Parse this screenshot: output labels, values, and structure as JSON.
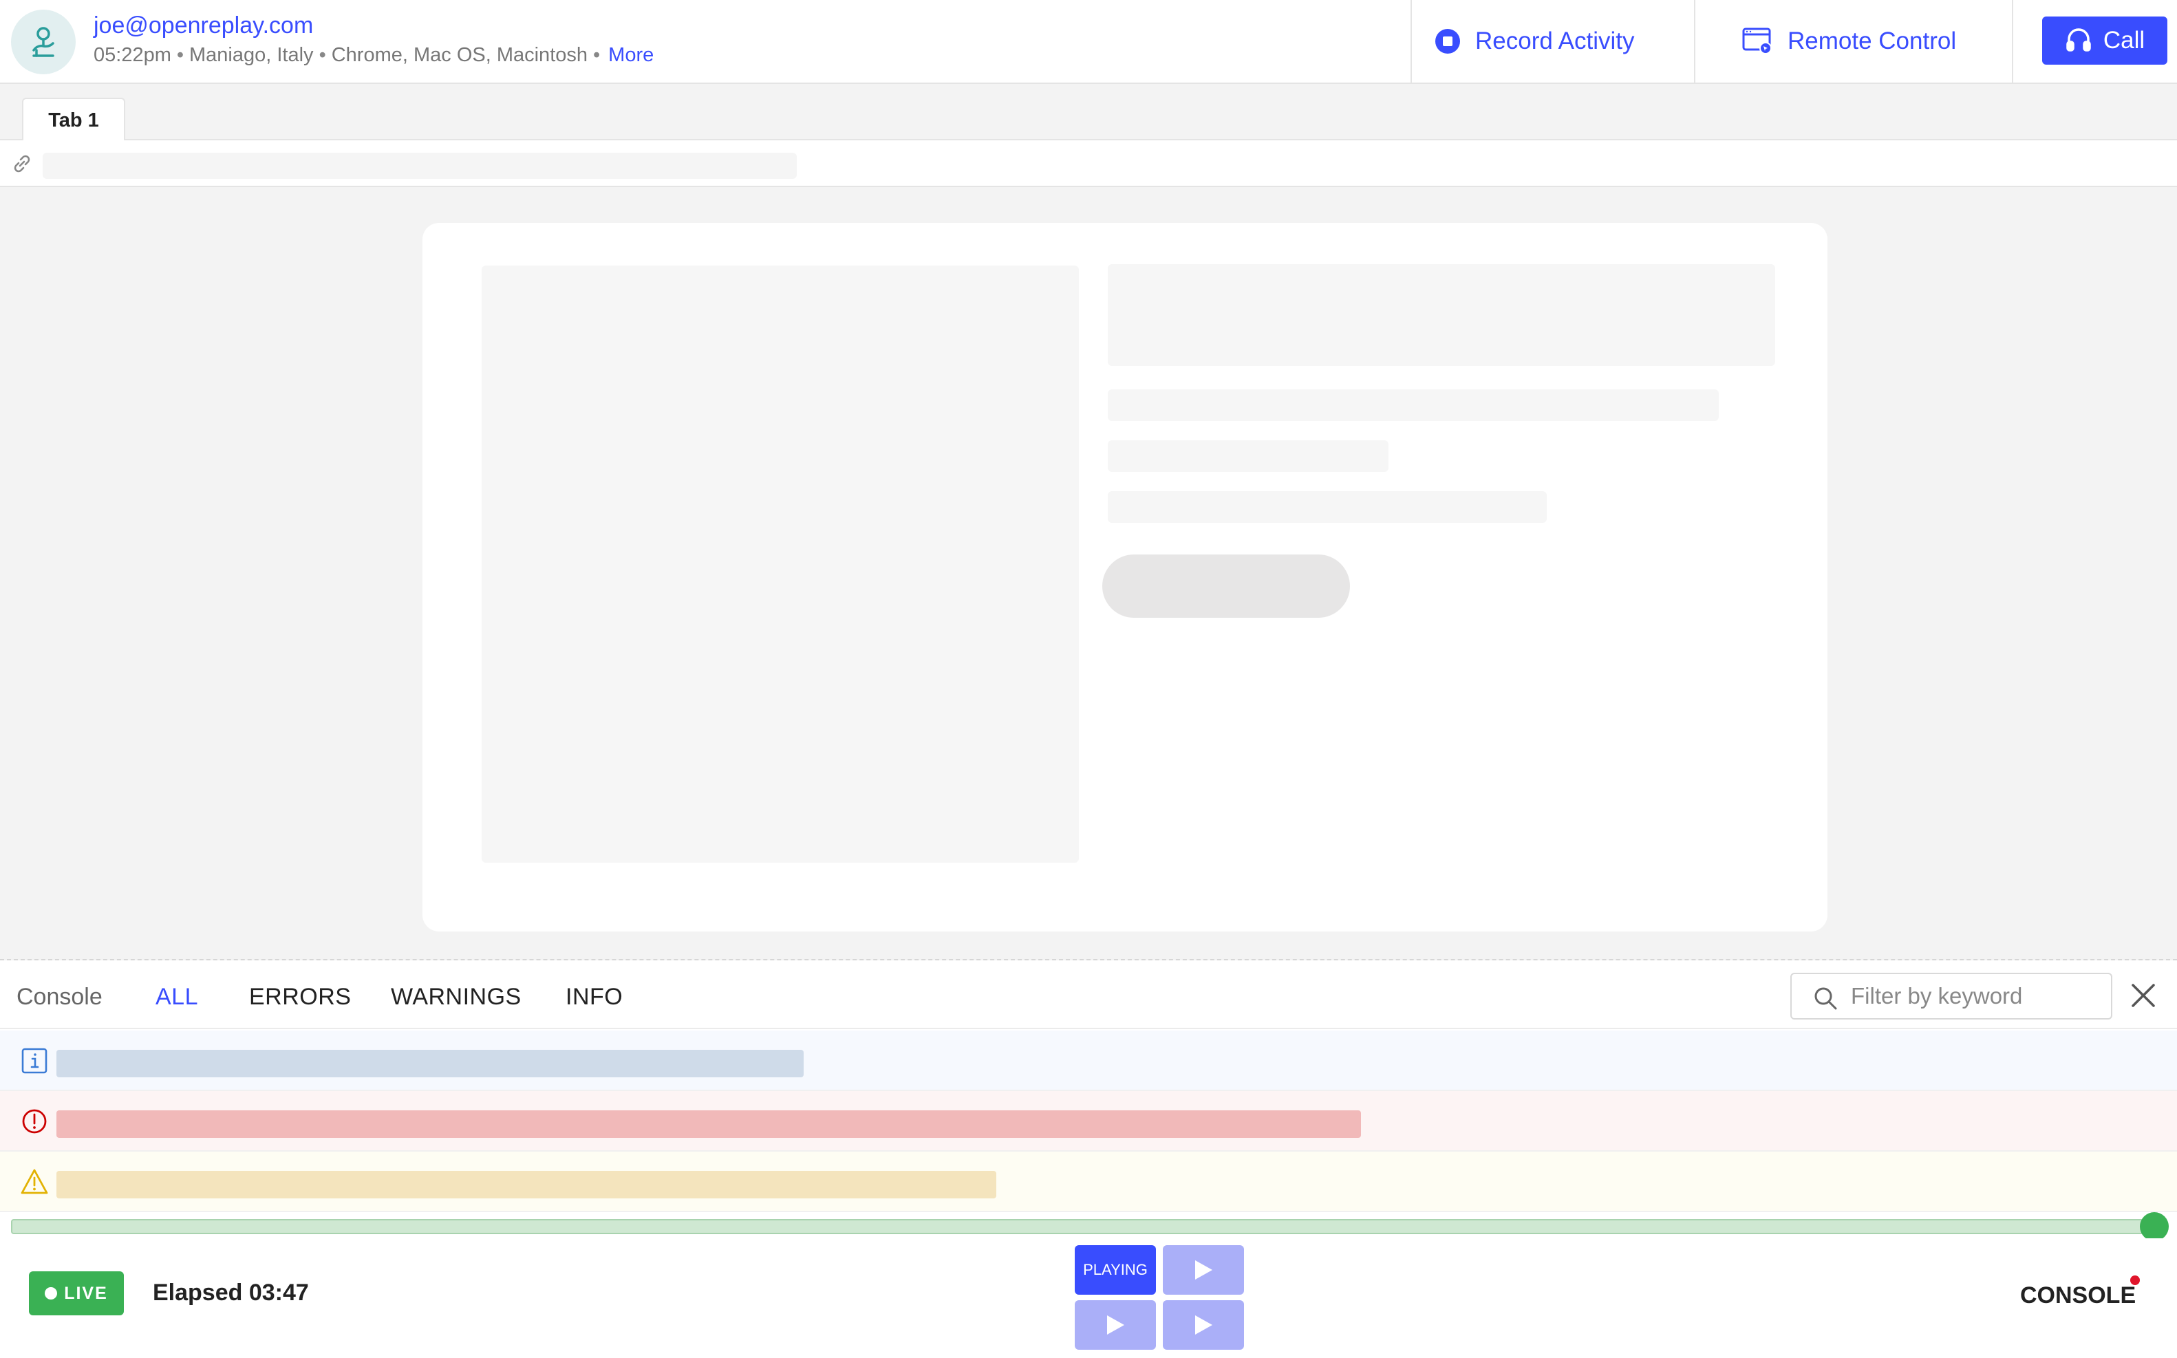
{
  "session": {
    "user_email": "joe@openreplay.com",
    "time": "05:22pm",
    "location": "Maniago, Italy",
    "environment": "Chrome, Mac OS, Macintosh",
    "more_label": "More",
    "separator": "•"
  },
  "header_actions": {
    "record_label": "Record Activity",
    "remote_label": "Remote Control",
    "call_label": "Call"
  },
  "tabs": [
    {
      "label": "Tab 1",
      "active": true
    }
  ],
  "console": {
    "title": "Console",
    "filters": [
      {
        "label": "ALL",
        "active": true
      },
      {
        "label": "ERRORS",
        "active": false
      },
      {
        "label": "WARNINGS",
        "active": false
      },
      {
        "label": "INFO",
        "active": false
      }
    ],
    "search_placeholder": "Filter by keyword",
    "rows": [
      {
        "level": "info",
        "icon": "info-icon"
      },
      {
        "level": "error",
        "icon": "error-icon"
      },
      {
        "level": "warning",
        "icon": "warning-icon"
      }
    ]
  },
  "timeline": {
    "progress": 1.0
  },
  "player": {
    "live_label": "LIVE",
    "elapsed_label": "Elapsed 03:47",
    "playing_label": "PLAYING",
    "console_toggle_label": "CONSOLE"
  },
  "colors": {
    "accent": "#394dfe",
    "live_green": "#3ab154",
    "error_red": "#cc0000",
    "warning_yellow": "#e2b203",
    "info_blue": "#3a7bd5"
  }
}
